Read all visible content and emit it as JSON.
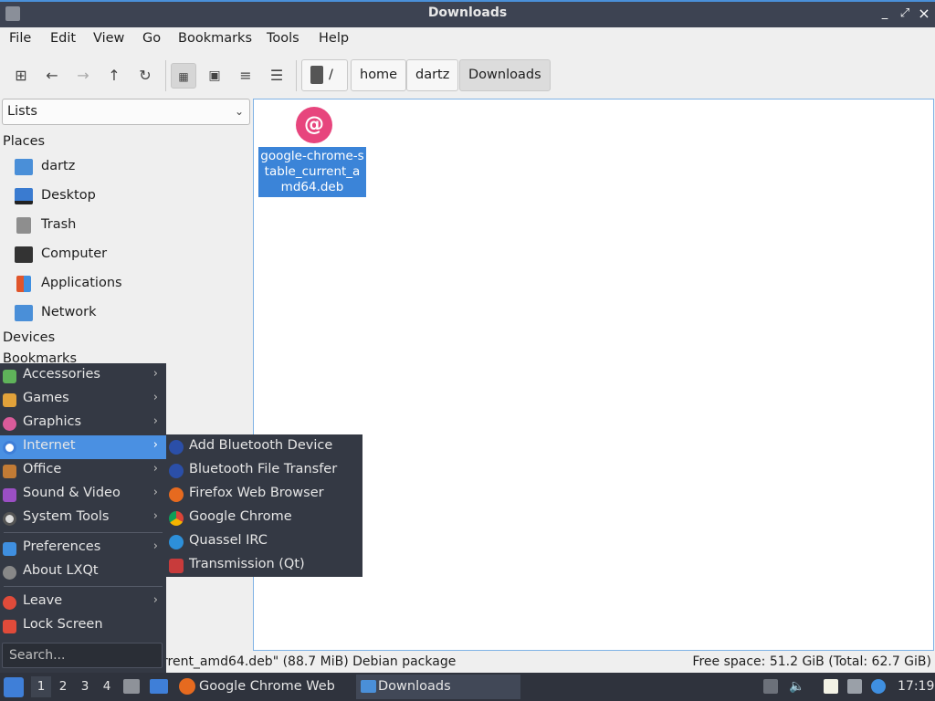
{
  "window": {
    "title": "Downloads",
    "minimize": "_",
    "maximize": "⤢",
    "close": "×"
  },
  "menubar": [
    "File",
    "Edit",
    "View",
    "Go",
    "Bookmarks",
    "Tools",
    "Help"
  ],
  "breadcrumb": [
    "/",
    "home",
    "dartz",
    "Downloads"
  ],
  "sidepanel": {
    "mode": "Lists",
    "places_header": "Places",
    "places": [
      {
        "label": "dartz",
        "icon": "home-folder-icon",
        "color": "#4a8fd8"
      },
      {
        "label": "Desktop",
        "icon": "desktop-icon",
        "color": "#3a7bd0"
      },
      {
        "label": "Trash",
        "icon": "trash-icon",
        "color": "#8e8e8e"
      },
      {
        "label": "Computer",
        "icon": "computer-icon",
        "color": "#333333"
      },
      {
        "label": "Applications",
        "icon": "applications-icon",
        "color": "#e0552b"
      },
      {
        "label": "Network",
        "icon": "network-folder-icon",
        "color": "#4a8fd8"
      }
    ],
    "devices_header": "Devices",
    "bookmarks_header": "Bookmarks"
  },
  "files": [
    {
      "name": "google-chrome-stable_current_amd64.deb",
      "icon": "debian-package-icon",
      "selected": true
    }
  ],
  "statusbar": {
    "selection": "rrent_amd64.deb\" (88.7 MiB) Debian package",
    "free_space": "Free space: 51.2 GiB (Total: 62.7 GiB)"
  },
  "startmenu": {
    "categories": [
      {
        "label": "Accessories",
        "icon": "accessories-icon",
        "color": "#5fb35a",
        "has_submenu": true
      },
      {
        "label": "Games",
        "icon": "games-icon",
        "color": "#e2a23a",
        "has_submenu": true
      },
      {
        "label": "Graphics",
        "icon": "graphics-icon",
        "color": "#d95b9a",
        "has_submenu": true
      },
      {
        "label": "Internet",
        "icon": "internet-icon",
        "color": "#3f7fd8",
        "has_submenu": true,
        "highlighted": true
      },
      {
        "label": "Office",
        "icon": "office-icon",
        "color": "#c27b35",
        "has_submenu": true
      },
      {
        "label": "Sound & Video",
        "icon": "sound-video-icon",
        "color": "#9b4fc4",
        "has_submenu": true
      },
      {
        "label": "System Tools",
        "icon": "system-tools-icon",
        "color": "#dddddd",
        "has_submenu": true
      }
    ],
    "preferences": {
      "label": "Preferences",
      "icon": "preferences-icon",
      "color": "#3f8fe0"
    },
    "about": {
      "label": "About LXQt",
      "icon": "info-icon",
      "color": "#888888"
    },
    "leave": {
      "label": "Leave",
      "icon": "power-icon",
      "color": "#e04b3a"
    },
    "lock": {
      "label": "Lock Screen",
      "icon": "lock-icon",
      "color": "#e04b3a"
    },
    "search_placeholder": "Search..."
  },
  "submenu_internet": [
    {
      "label": "Add Bluetooth Device",
      "icon": "bluetooth-icon",
      "color": "#2b4fa8"
    },
    {
      "label": "Bluetooth File Transfer",
      "icon": "bluetooth-icon",
      "color": "#2b4fa8"
    },
    {
      "label": "Firefox Web Browser",
      "icon": "firefox-icon",
      "color": "#e66a1f"
    },
    {
      "label": "Google Chrome",
      "icon": "chrome-icon",
      "color": "#e8b83a"
    },
    {
      "label": "Quassel IRC",
      "icon": "quassel-icon",
      "color": "#2d8fd9"
    },
    {
      "label": "Transmission (Qt)",
      "icon": "transmission-icon",
      "color": "#c83b3b"
    }
  ],
  "taskbar": {
    "workspaces": [
      "1",
      "2",
      "3",
      "4"
    ],
    "tasks": [
      {
        "label": "Google Chrome Web ...",
        "icon": "firefox-icon"
      },
      {
        "label": "Downloads",
        "icon": "folder-icon",
        "active": true
      }
    ],
    "clock": "17:19"
  }
}
